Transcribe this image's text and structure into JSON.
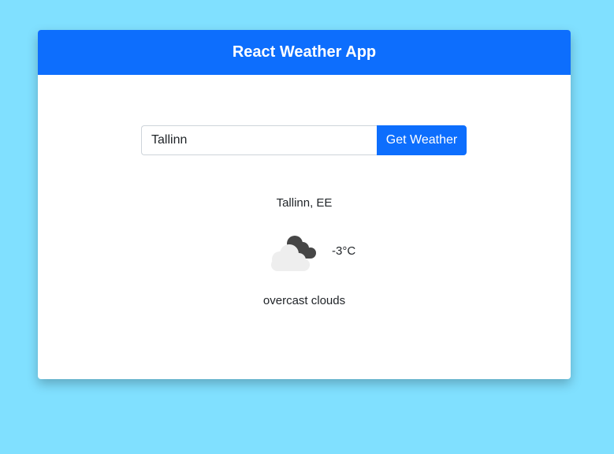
{
  "app": {
    "title": "React Weather App"
  },
  "search": {
    "value": "Tallinn",
    "button_label": "Get Weather"
  },
  "weather": {
    "location": "Tallinn, EE",
    "temperature": "-3°C",
    "description": "overcast clouds",
    "icon": "overcast-clouds-icon"
  },
  "colors": {
    "page_background": "#80e0ff",
    "header_background": "#0d6efd",
    "button_background": "#0d6efd",
    "card_background": "#ffffff"
  }
}
